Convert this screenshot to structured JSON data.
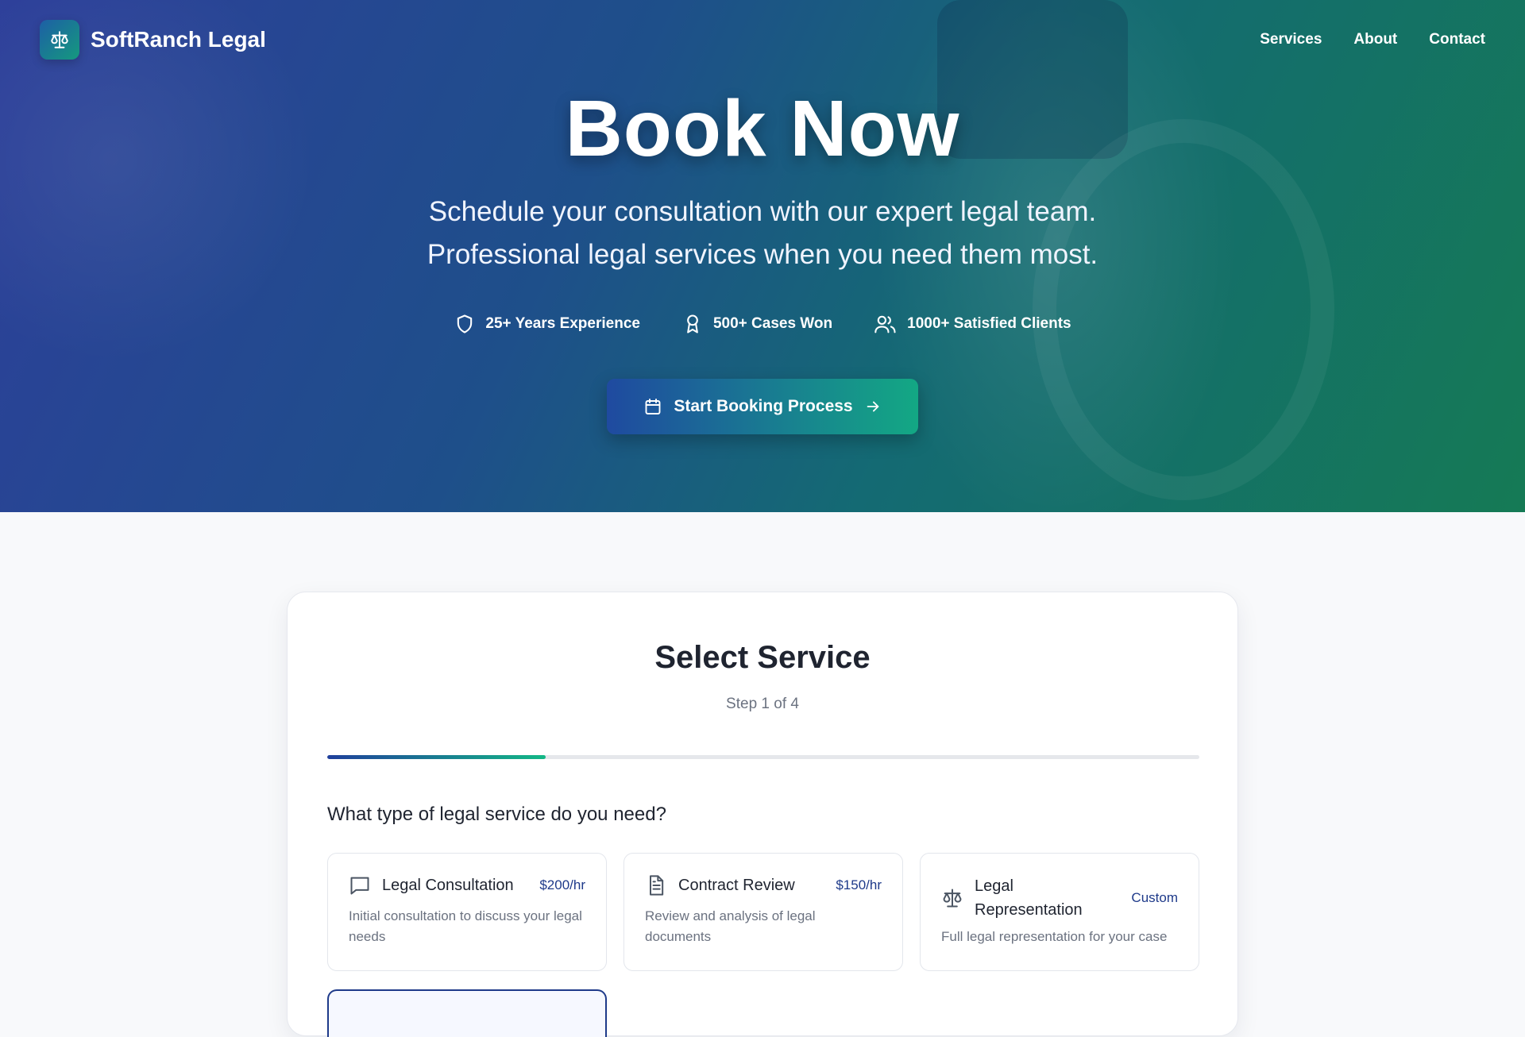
{
  "brand": {
    "name": "SoftRanch Legal",
    "logo_icon": "scales-icon"
  },
  "nav": {
    "items": [
      "Services",
      "About",
      "Contact"
    ]
  },
  "hero": {
    "title": "Book Now",
    "subtitle_line1": "Schedule your consultation with our expert legal team.",
    "subtitle_line2": "Professional legal services when you need them most.",
    "stats": [
      {
        "icon": "shield-icon",
        "label": "25+ Years Experience"
      },
      {
        "icon": "award-icon",
        "label": "500+ Cases Won"
      },
      {
        "icon": "users-icon",
        "label": "1000+ Satisfied Clients"
      }
    ],
    "cta_label": "Start Booking Process"
  },
  "booking": {
    "title": "Select Service",
    "step": "Step 1 of 4",
    "progress": 0.25,
    "question": "What type of legal service do you need?",
    "services": [
      {
        "icon": "message-icon",
        "name": "Legal Consultation",
        "price": "$200/hr",
        "description": "Initial consultation to discuss your legal needs"
      },
      {
        "icon": "document-icon",
        "name": "Contract Review",
        "price": "$150/hr",
        "description": "Review and analysis of legal documents"
      },
      {
        "icon": "scales-icon",
        "name": "Legal Representation",
        "price": "Custom",
        "description": "Full legal representation for your case"
      }
    ]
  },
  "colors": {
    "accent_blue": "#1e3a8a",
    "accent_green": "#13b886"
  }
}
